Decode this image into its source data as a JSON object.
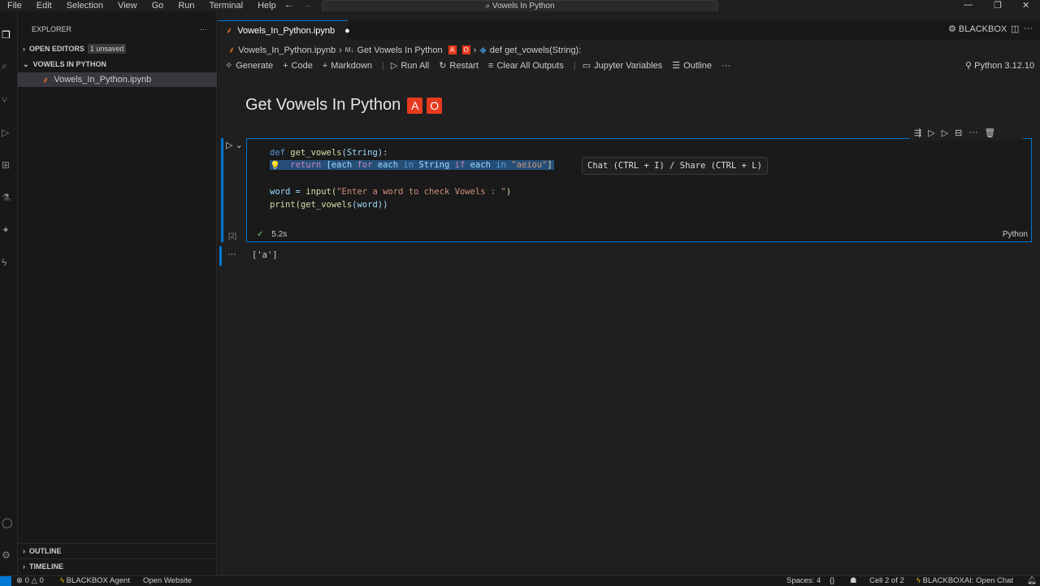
{
  "menu": [
    "File",
    "Edit",
    "Selection",
    "View",
    "Go",
    "Run",
    "Terminal",
    "Help"
  ],
  "search": "Vowels In Python",
  "sidebar": {
    "title": "EXPLORER",
    "open_editors": "OPEN EDITORS",
    "unsaved": "1 unsaved",
    "folder": "VOWELS IN PYTHON",
    "file": "Vowels_In_Python.ipynb",
    "outline": "OUTLINE",
    "timeline": "TIMELINE"
  },
  "tab": {
    "label": "Vowels_In_Python.ipynb"
  },
  "topright": {
    "blackbox": "BLACKBOX"
  },
  "breadcrumb": {
    "file": "Vowels_In_Python.ipynb",
    "md": "Get Vowels In Python",
    "a": "A",
    "o": "O",
    "def": "def get_vowels(String):"
  },
  "toolbar": {
    "generate": "Generate",
    "code": "Code",
    "markdown": "Markdown",
    "run_all": "Run All",
    "restart": "Restart",
    "clear": "Clear All Outputs",
    "vars": "Jupyter Variables",
    "outline": "Outline",
    "kernel": "Python 3.12.10"
  },
  "notebook": {
    "title": "Get Vowels In Python",
    "badge_a": "A",
    "badge_o": "O",
    "code": {
      "l1a": "def",
      "l1b": " get_vowels",
      "l1c": "(String):",
      "l2a": "    return",
      "l2b": " [each ",
      "l2c": "for",
      "l2d": " each ",
      "l2e": "in",
      "l2f": " String ",
      "l2g": "if",
      "l2h": " each ",
      "l2i": "in",
      "l2j": " \"aeiou\"",
      "l2k": "]",
      "l4a": "word = ",
      "l4b": "input",
      "l4c": "(",
      "l4d": "\"Enter a word to check Vowels : \"",
      "l4e": ")",
      "l5a": "print",
      "l5b": "(",
      "l5c": "get_vowels",
      "l5d": "(word))"
    },
    "hint": "Chat (CTRL + I) / Share (CTRL + L)",
    "exec_count": "[2]",
    "time": "5.2s",
    "lang": "Python",
    "output": "['a']"
  },
  "status": {
    "errors": "0",
    "warnings": "0",
    "agent": "BLACKBOX Agent",
    "website": "Open Website",
    "spaces": "Spaces: 4",
    "braces": "{}",
    "cell": "Cell 2 of 2",
    "chat": "BLACKBOXAI: Open Chat"
  }
}
